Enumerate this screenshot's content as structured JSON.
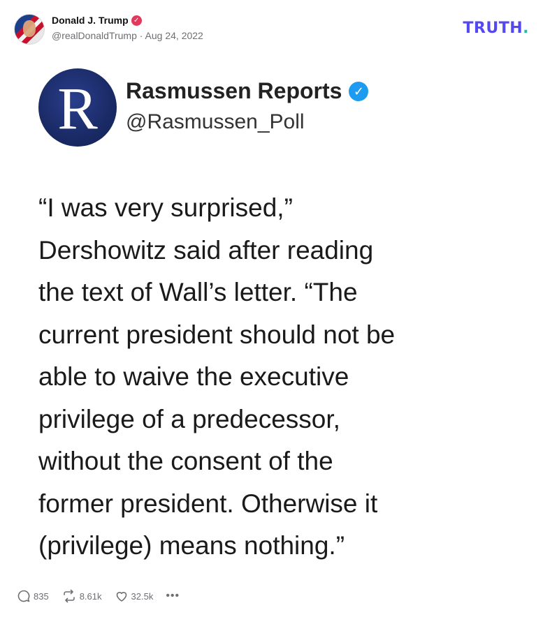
{
  "post": {
    "author_name": "Donald J. Trump",
    "author_handle": "@realDonaldTrump",
    "separator": "·",
    "date": "Aug 24, 2022"
  },
  "brand": {
    "logo_text": "TRUTH",
    "logo_dot": "."
  },
  "embedded": {
    "logo_letter": "R",
    "source_name": "Rasmussen Reports",
    "source_handle": "@Rasmussen_Poll",
    "quote_text": "“I was very surprised,”\nDershowitz said after reading\nthe text of Wall’s letter. “The\ncurrent president should not be\nable to waive the executive\nprivilege of a predecessor,\nwithout the consent of the\nformer president. Otherwise it\n(privilege) means nothing.”"
  },
  "actions": {
    "replies": "835",
    "retruths": "8.61k",
    "likes": "32.5k",
    "more_label": "•••"
  },
  "colors": {
    "brand_purple": "#5448ee",
    "brand_teal": "#16c4a6",
    "verified_pink": "#e0395b",
    "verified_blue": "#1d9bf0",
    "rasmussen_navy": "#1a2a66"
  },
  "icons": {
    "verified_badge": "verified-check-icon",
    "source_verified": "verified-check-icon",
    "reply": "reply-icon",
    "retruth": "retruth-icon",
    "like": "heart-icon",
    "more": "more-icon"
  }
}
